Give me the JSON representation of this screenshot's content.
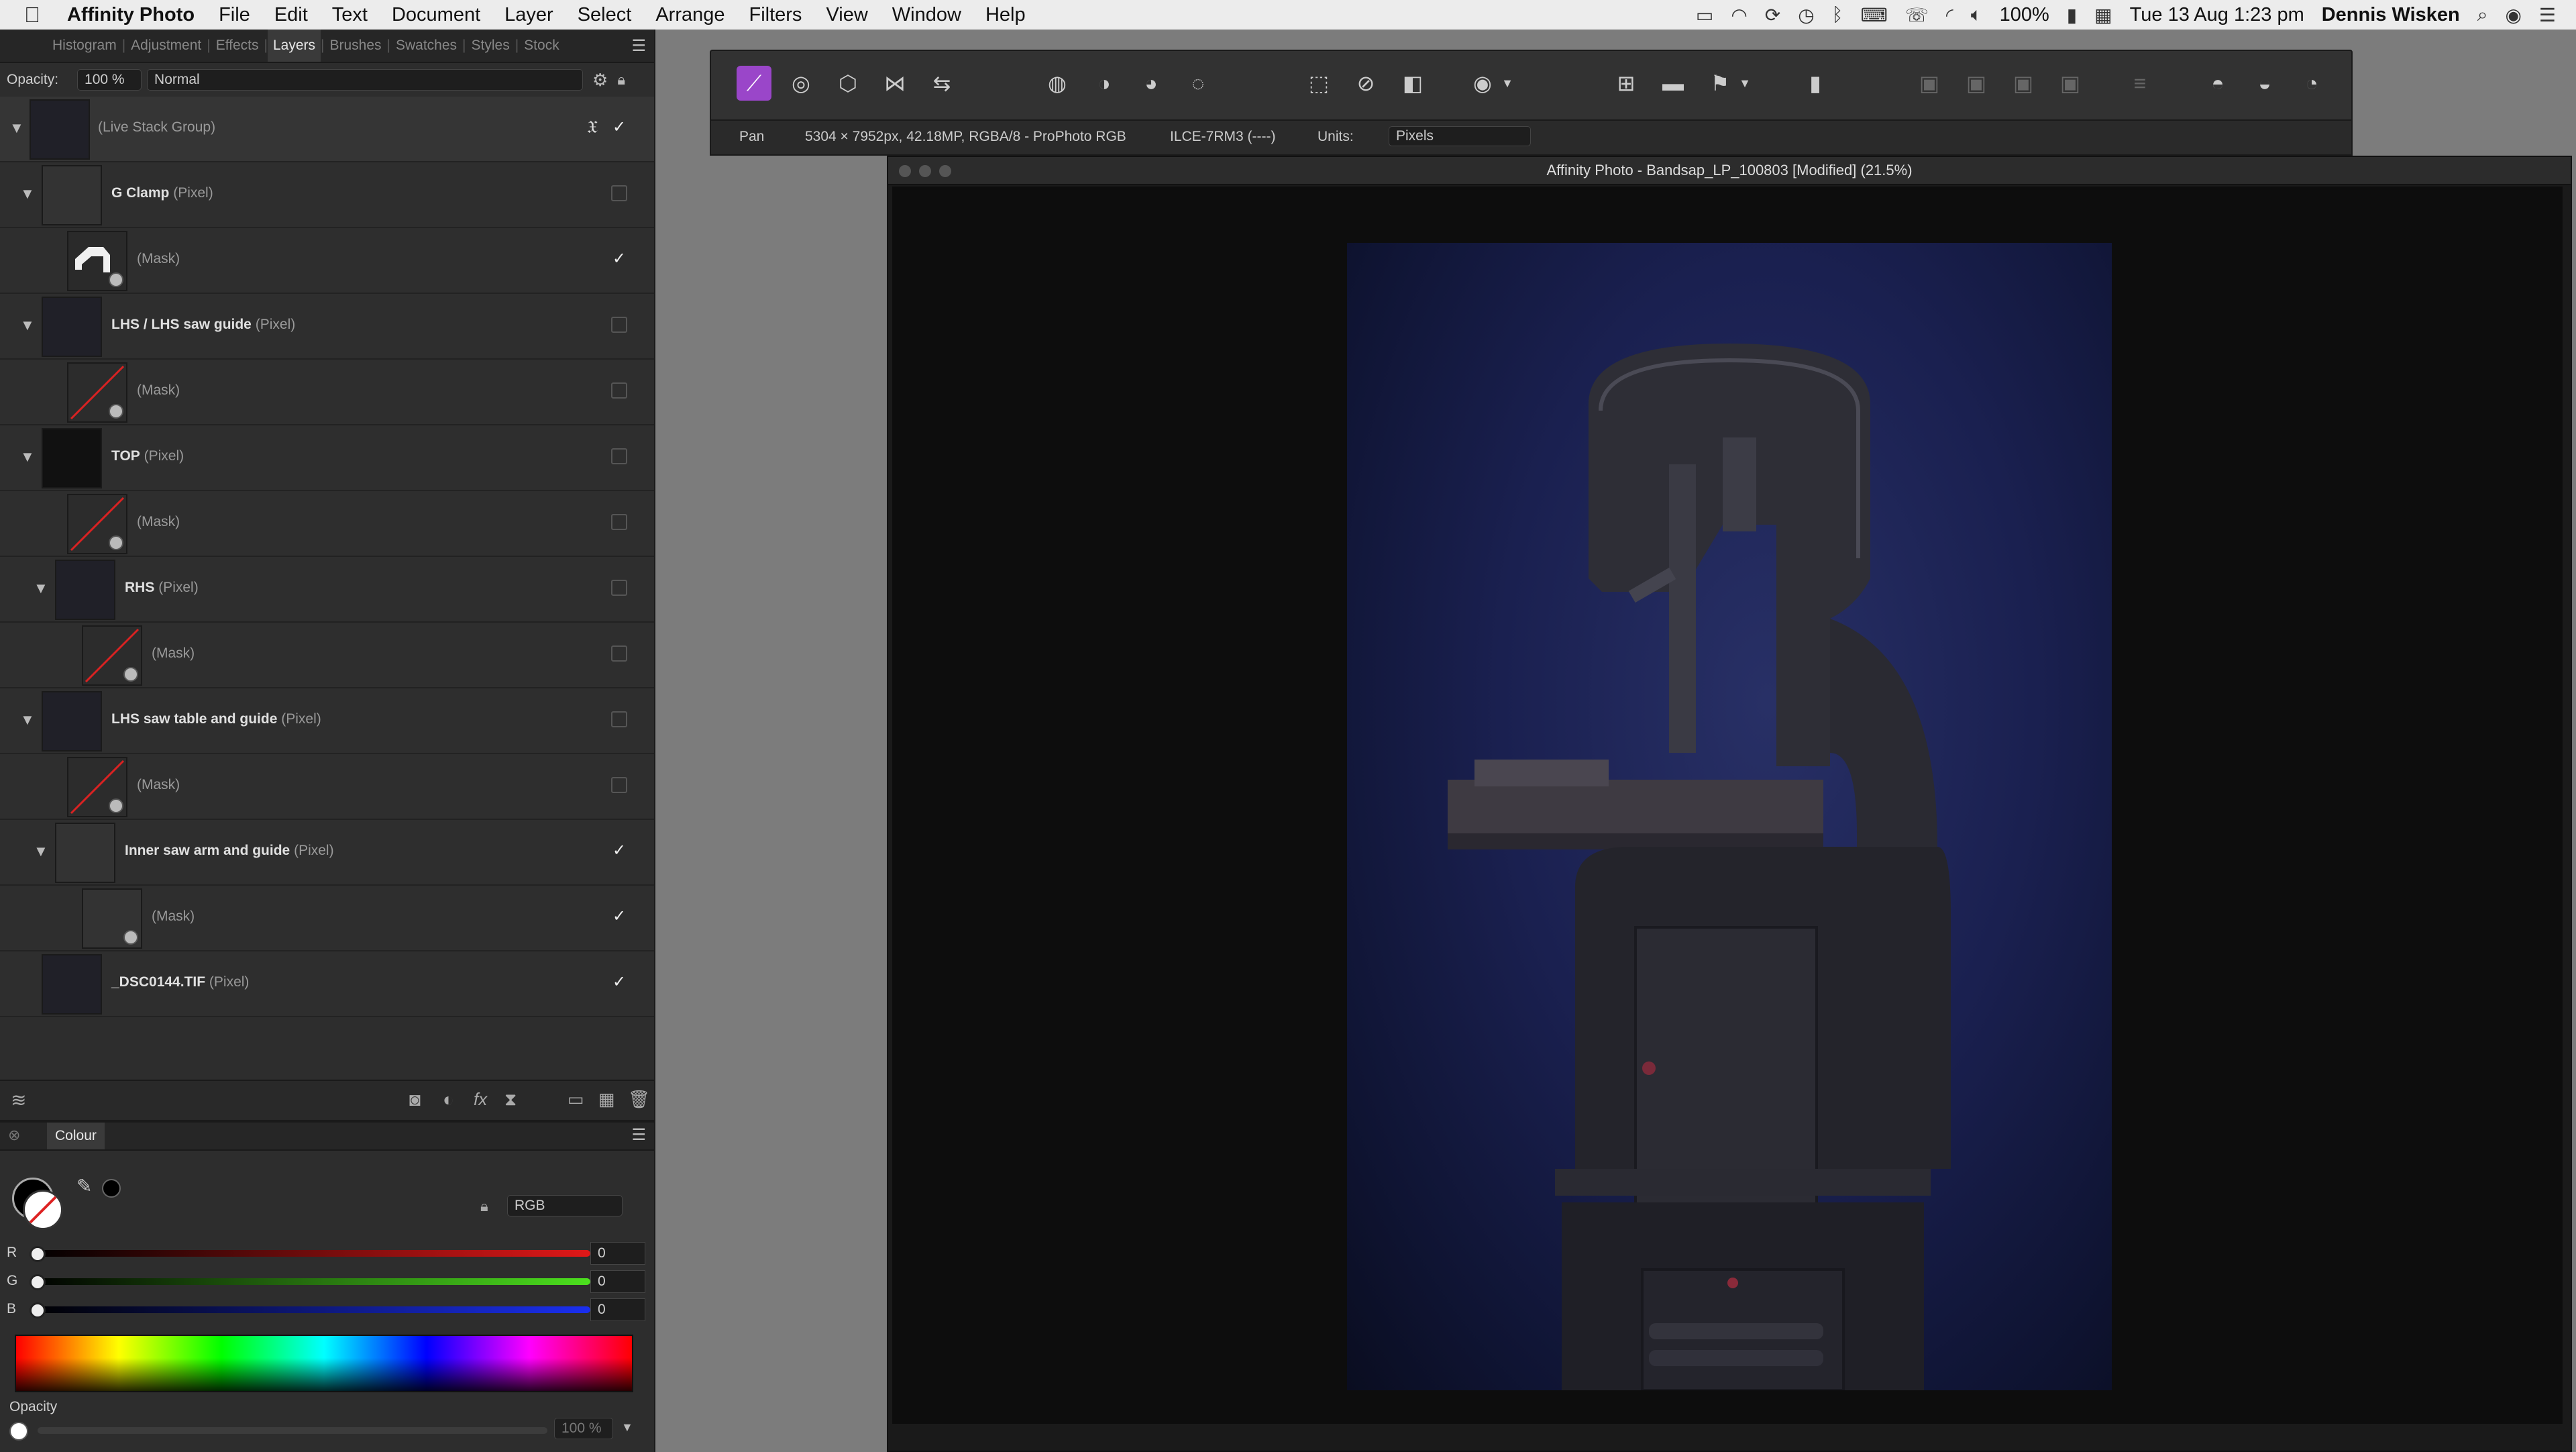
{
  "menubar": {
    "app_name": "Affinity Photo",
    "items": [
      "File",
      "Edit",
      "Text",
      "Document",
      "Layer",
      "Select",
      "Arrange",
      "Filters",
      "View",
      "Window",
      "Help"
    ],
    "battery": "100%",
    "datetime": "Tue 13 Aug  1:23 pm",
    "user": "Dennis Wisken"
  },
  "panel_tabs": [
    "Histogram",
    "Adjustment",
    "Effects",
    "Layers",
    "Brushes",
    "Swatches",
    "Styles",
    "Stock"
  ],
  "layers": {
    "opacity_label": "Opacity:",
    "opacity_value": "100 %",
    "blend_mode": "Normal",
    "rows": [
      {
        "name": "",
        "kind": "(Live Stack Group)",
        "visible": true
      },
      {
        "name": "G Clamp",
        "kind": "(Pixel)",
        "visible": false
      },
      {
        "name": "",
        "kind": "(Mask)",
        "visible": true
      },
      {
        "name": "LHS / LHS saw guide",
        "kind": "(Pixel)",
        "visible": false
      },
      {
        "name": "",
        "kind": "(Mask)",
        "visible": false
      },
      {
        "name": "TOP",
        "kind": "(Pixel)",
        "visible": false
      },
      {
        "name": "",
        "kind": "(Mask)",
        "visible": false
      },
      {
        "name": "RHS",
        "kind": "(Pixel)",
        "visible": false
      },
      {
        "name": "",
        "kind": "(Mask)",
        "visible": false
      },
      {
        "name": "LHS saw table and guide",
        "kind": "(Pixel)",
        "visible": false
      },
      {
        "name": "",
        "kind": "(Mask)",
        "visible": false
      },
      {
        "name": "Inner saw arm and guide",
        "kind": "(Pixel)",
        "visible": true
      },
      {
        "name": "",
        "kind": "(Mask)",
        "visible": true
      },
      {
        "name": "_DSC0144.TIF",
        "kind": "(Pixel)",
        "visible": true
      }
    ]
  },
  "colour": {
    "title": "Colour",
    "model": "RGB",
    "channels": [
      {
        "label": "R",
        "value": "0",
        "color": "#d01a1a"
      },
      {
        "label": "G",
        "value": "0",
        "color": "#3fcf1f"
      },
      {
        "label": "B",
        "value": "0",
        "color": "#1a2fe0"
      }
    ],
    "opacity_label": "Opacity",
    "opacity_value": "100 %"
  },
  "context": {
    "tool": "Pan",
    "doc_info": "5304 × 7952px, 42.18MP, RGBA/8 - ProPhoto RGB",
    "camera": "ILCE-7RM3 (----)",
    "units_label": "Units:",
    "units_value": "Pixels"
  },
  "document": {
    "title": "Affinity Photo - Bandsap_LP_100803 [Modified] (21.5%)"
  }
}
